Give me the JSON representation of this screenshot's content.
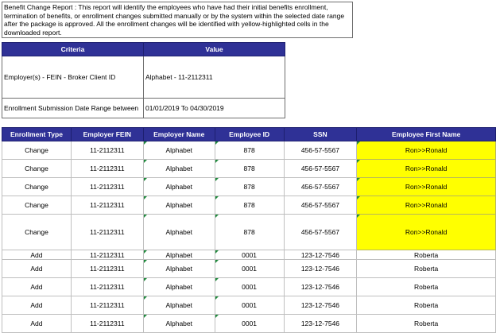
{
  "description": "Benefit Change Report : This report will identify the employees who have had their initial benefits enrollment, termination of benefits, or enrollment changes submitted manually or by the system within the selected date range after the package is approved. All the enrollment changes will be identified with yellow-highlighted cells in the downloaded report.",
  "criteria": {
    "headers": [
      "Criteria",
      "Value"
    ],
    "rows": [
      {
        "label": "Employer(s) - FEIN - Broker Client ID",
        "value": "Alphabet - 11-2112311"
      },
      {
        "label": "Enrollment Submission Date Range between",
        "value": "01/01/2019 To 04/30/2019"
      }
    ]
  },
  "grid": {
    "headers": [
      "Enrollment Type",
      "Employer FEIN",
      "Employer Name",
      "Employee ID",
      "SSN",
      "Employee First Name"
    ],
    "rows": [
      {
        "type": "Change",
        "fein": "11-2112311",
        "name": "Alphabet",
        "id": "878",
        "ssn": "456-57-5567",
        "first": "Ron>>Ronald",
        "highlight": true
      },
      {
        "type": "Change",
        "fein": "11-2112311",
        "name": "Alphabet",
        "id": "878",
        "ssn": "456-57-5567",
        "first": "Ron>>Ronald",
        "highlight": true
      },
      {
        "type": "Change",
        "fein": "11-2112311",
        "name": "Alphabet",
        "id": "878",
        "ssn": "456-57-5567",
        "first": "Ron>>Ronald",
        "highlight": true
      },
      {
        "type": "Change",
        "fein": "11-2112311",
        "name": "Alphabet",
        "id": "878",
        "ssn": "456-57-5567",
        "first": "Ron>>Ronald",
        "highlight": true
      },
      {
        "type": "Change",
        "fein": "11-2112311",
        "name": "Alphabet",
        "id": "878",
        "ssn": "456-57-5567",
        "first": "Ron>>Ronald",
        "highlight": true
      },
      {
        "type": "Add",
        "fein": "11-2112311",
        "name": "Alphabet",
        "id": "0001",
        "ssn": "123-12-7546",
        "first": "Roberta",
        "highlight": false
      },
      {
        "type": "Add",
        "fein": "11-2112311",
        "name": "Alphabet",
        "id": "0001",
        "ssn": "123-12-7546",
        "first": "Roberta",
        "highlight": false
      },
      {
        "type": "Add",
        "fein": "11-2112311",
        "name": "Alphabet",
        "id": "0001",
        "ssn": "123-12-7546",
        "first": "Roberta",
        "highlight": false
      },
      {
        "type": "Add",
        "fein": "11-2112311",
        "name": "Alphabet",
        "id": "0001",
        "ssn": "123-12-7546",
        "first": "Roberta",
        "highlight": false
      },
      {
        "type": "Add",
        "fein": "11-2112311",
        "name": "Alphabet",
        "id": "0001",
        "ssn": "123-12-7546",
        "first": "Roberta",
        "highlight": false
      }
    ]
  },
  "colors": {
    "header_bg": "#2f3196",
    "highlight": "#ffff00",
    "comment_marker": "#1f8a3c"
  }
}
